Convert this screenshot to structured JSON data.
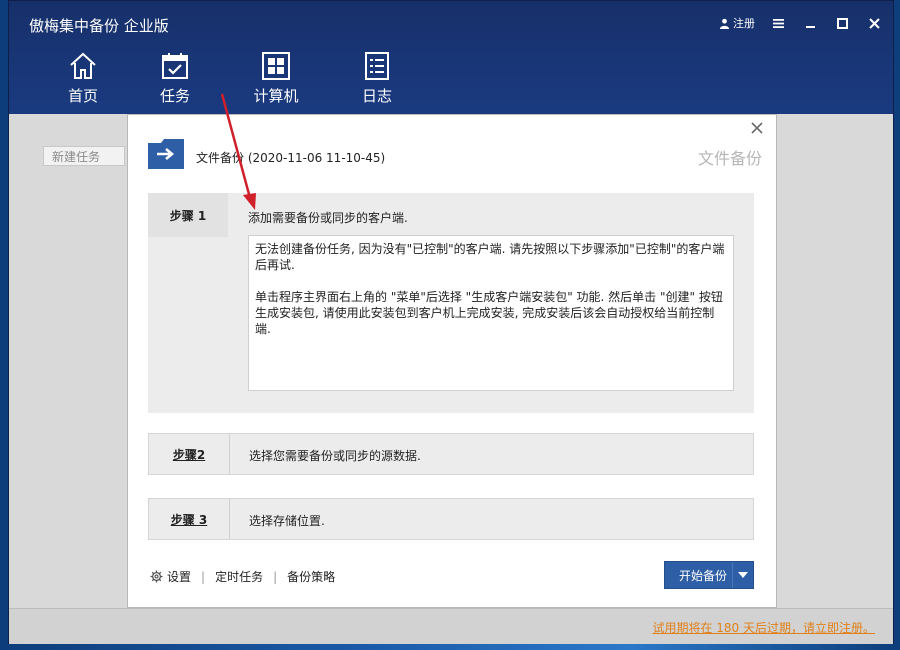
{
  "app": {
    "title": "傲梅集中备份 企业版",
    "register_label": "注册"
  },
  "nav": [
    {
      "label": "首页",
      "icon": "home-icon"
    },
    {
      "label": "任务",
      "icon": "calendar-check-icon"
    },
    {
      "label": "计算机",
      "icon": "windows-icon"
    },
    {
      "label": "日志",
      "icon": "log-list-icon"
    }
  ],
  "left_panel": {
    "new_task_label": "新建任务"
  },
  "dialog": {
    "title": "文件备份 (2020-11-06 11-10-45)",
    "watermark_title": "文件备份",
    "step1": {
      "label": "步骤 1",
      "desc": "添加需要备份或同步的客户端.",
      "message_p1": "无法创建备份任务, 因为没有\"已控制\"的客户端. 请先按照以下步骤添加\"已控制\"的客户端后再试.",
      "message_p2": "单击程序主界面右上角的 \"菜单\"后选择 \"生成客户端安装包\" 功能. 然后单击 \"创建\" 按钮生成安装包, 请使用此安装包到客户机上完成安装, 完成安装后该会自动授权给当前控制端."
    },
    "step2": {
      "label": "步骤2",
      "desc": "选择您需要备份或同步的源数据."
    },
    "step3": {
      "label": "步骤 3",
      "desc": "选择存储位置."
    },
    "footer": {
      "settings_label": "设置",
      "schedule_label": "定时任务",
      "policy_label": "备份策略",
      "start_label": "开始备份"
    }
  },
  "status": {
    "trial_text": "试用期将在 180 天后过期，请立即注册。"
  },
  "colors": {
    "title_bar": "#17306a",
    "accent_button": "#2e5fa6",
    "trial_text": "#e0801a",
    "annotation_arrow": "#d0202a"
  }
}
